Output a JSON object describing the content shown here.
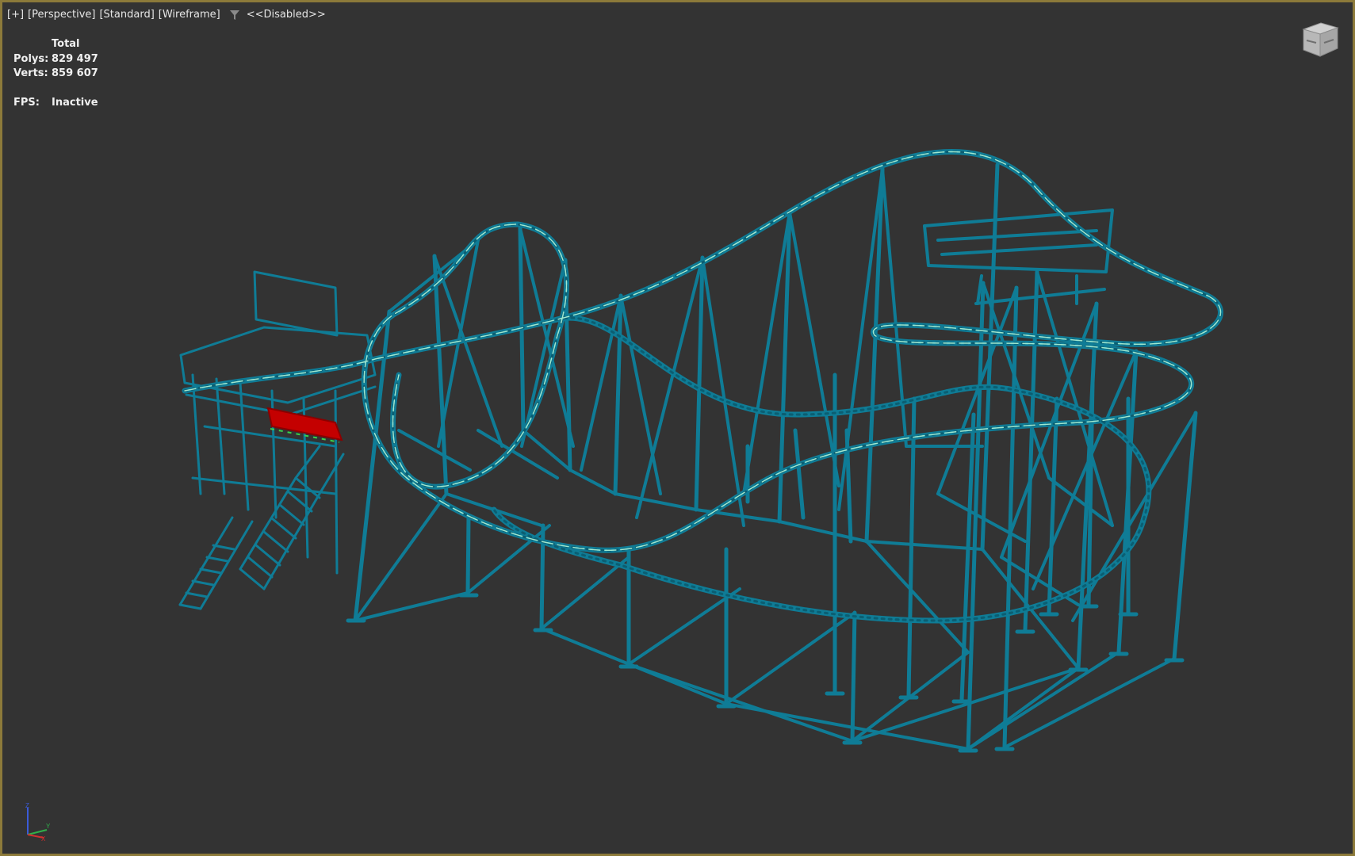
{
  "viewport": {
    "labels": {
      "plus": "[+]",
      "view": "[Perspective]",
      "shading": "[Standard]",
      "style": "[Wireframe]",
      "filter_icon": "funnel-filter-icon",
      "filter_state": "<<Disabled>>"
    },
    "stats": {
      "header": "Total",
      "polys_label": "Polys:",
      "polys_value": "829 497",
      "verts_label": "Verts:",
      "verts_value": "859 607",
      "fps_label": "FPS:",
      "fps_value": "Inactive"
    },
    "viewcube_icon": "viewcube-icon",
    "axis_icon": "axis-tripod-icon",
    "axis_labels": {
      "z": "Z",
      "y": "Y",
      "x": "X"
    },
    "scene_object": "roller-coaster-wireframe-model",
    "colors": {
      "background": "#333333",
      "frame_border": "#8c7a3a",
      "wireframe": "#0f7c96",
      "track_highlight": "#9fe8d0",
      "train": "#c40000",
      "train_seats": "#39d24a",
      "text": "#e6e6e6"
    }
  }
}
